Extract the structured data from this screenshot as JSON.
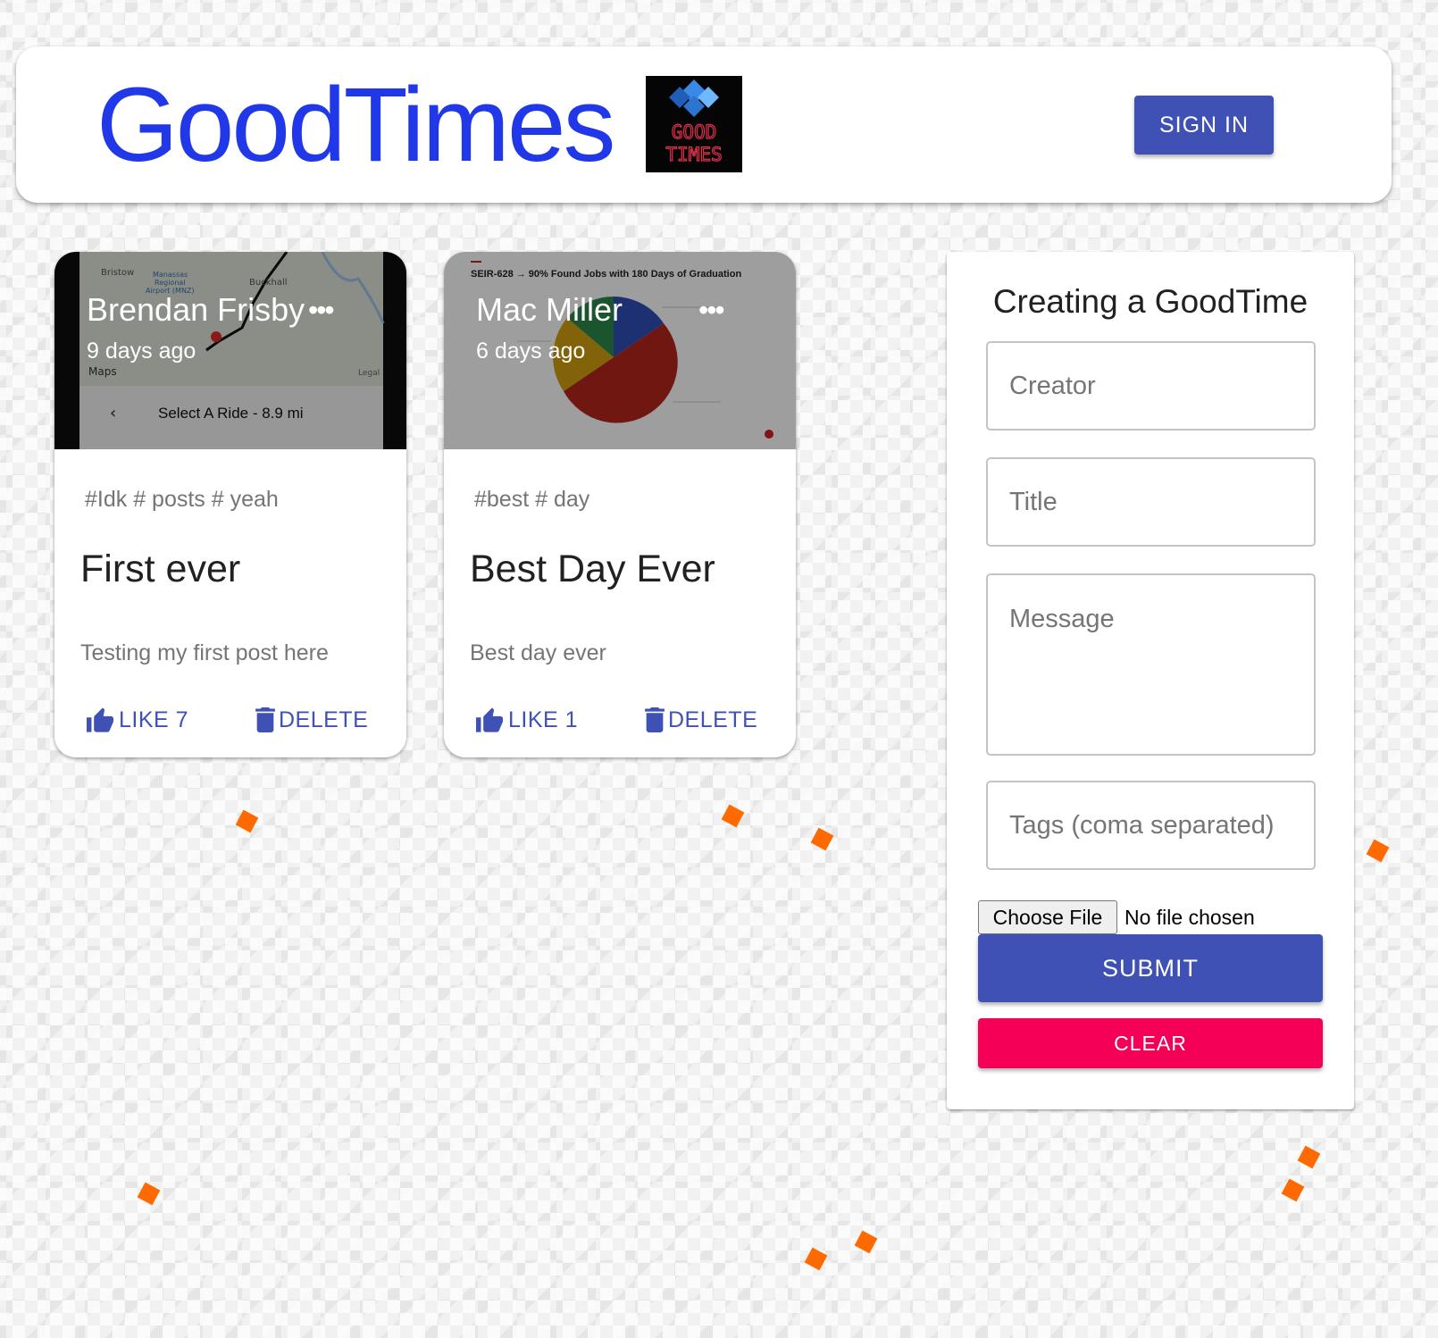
{
  "header": {
    "brand_title": "GoodTimes",
    "logo_text_line1": "GOOD",
    "logo_text_line2": "TIMES",
    "sign_in_label": "SIGN IN"
  },
  "posts": [
    {
      "creator": "Brendan Frisby",
      "time_ago": "9 days ago",
      "more_label": "•••",
      "tags": "#Idk # posts # yeah",
      "title": "First ever",
      "message": "Testing my first post here",
      "like_label": "LIKE 7",
      "delete_label": "DELETE",
      "image": {
        "type": "map-screenshot",
        "labels": [
          "Bristow",
          "Manassas Regional Airport (MNZ)",
          "Buckhall",
          "Maps",
          "Legal"
        ],
        "bottom_bar_text": "Select A Ride - 8.9 mi"
      }
    },
    {
      "creator": "Mac Miller",
      "time_ago": "6 days ago",
      "more_label": "•••",
      "tags": "#best # day",
      "title": "Best Day Ever",
      "message": "Best day ever",
      "like_label": "LIKE 1",
      "delete_label": "DELETE",
      "image": {
        "type": "slide-screenshot",
        "slide_title": "SEIR-628 → 90% Found Jobs with 180 Days of Graduation",
        "pie_colors": [
          "#b5261e",
          "#d4a010",
          "#2a8a4a",
          "#3050b8"
        ]
      }
    }
  ],
  "form": {
    "title": "Creating a GoodTime",
    "creator_placeholder": "Creator",
    "title_placeholder": "Title",
    "message_placeholder": "Message",
    "tags_placeholder": "Tags (coma separated)",
    "file_button_label": "Choose File",
    "file_status": "No file chosen",
    "submit_label": "SUBMIT",
    "clear_label": "CLEAR"
  },
  "colors": {
    "brand_blue": "#2038e8",
    "primary": "#3f51b5",
    "secondary": "#f50057",
    "background_accent": "#ff6a00"
  }
}
